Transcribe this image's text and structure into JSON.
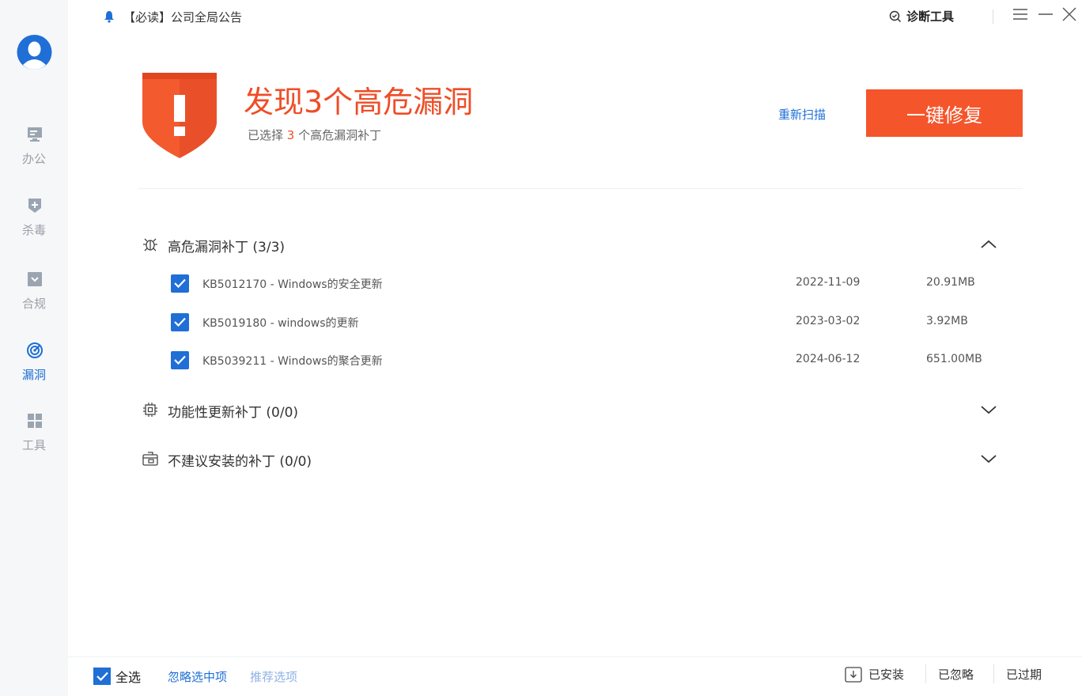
{
  "topbar": {
    "notice": "【必读】公司全局公告",
    "diag_tool": "诊断工具"
  },
  "sidebar": {
    "items": [
      {
        "label": "办公",
        "icon": "monitor-icon"
      },
      {
        "label": "杀毒",
        "icon": "shield-plus-icon"
      },
      {
        "label": "合规",
        "icon": "compliance-icon"
      },
      {
        "label": "漏洞",
        "icon": "radar-icon",
        "active": true
      },
      {
        "label": "工具",
        "icon": "grid-icon"
      }
    ]
  },
  "hero": {
    "title": "发现3个高危漏洞",
    "sub_prefix": "已选择",
    "sub_count": "3",
    "sub_suffix": "个高危漏洞补丁",
    "rescan": "重新扫描",
    "fix_all": "一键修复"
  },
  "sections": [
    {
      "title": "高危漏洞补丁 (3/3)",
      "icon": "bug-icon",
      "expanded": true,
      "rows": [
        {
          "name": "KB5012170 - Windows的安全更新",
          "date": "2022-11-09",
          "size": "20.91MB",
          "checked": true
        },
        {
          "name": "KB5019180 - windows的更新",
          "date": "2023-03-02",
          "size": "3.92MB",
          "checked": true
        },
        {
          "name": "KB5039211 - Windows的聚合更新",
          "date": "2024-06-12",
          "size": "651.00MB",
          "checked": true
        }
      ]
    },
    {
      "title": "功能性更新补丁 (0/0)",
      "icon": "chip-icon",
      "expanded": false
    },
    {
      "title": "不建议安装的补丁 (0/0)",
      "icon": "package-icon",
      "expanded": false
    }
  ],
  "footer": {
    "select_all": "全选",
    "ignore_selected": "忽略选中项",
    "recommended": "推荐选项",
    "installed": "已安装",
    "ignored": "已忽略",
    "expired": "已过期"
  },
  "colors": {
    "accent": "#1f6fd6",
    "danger": "#f5552b",
    "sidebar_bg": "#f6f7f9"
  }
}
